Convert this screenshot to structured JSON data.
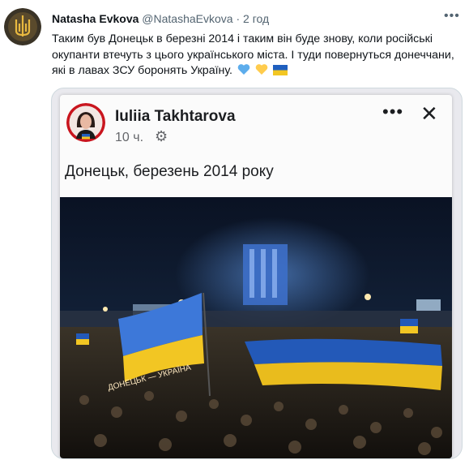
{
  "tweet": {
    "author_name": "Natasha Evkova",
    "author_handle": "@NatashaEvkova",
    "separator": "·",
    "time": "2 год",
    "more_label": "•••",
    "text": "Таким був Донецьк в березні 2014 і таким він буде знову, коли російські окупанти втечуть з цього українського міста. І туди повернуться донеччани, які в лавах ЗСУ боронять Україну.",
    "emojis": [
      "blue-heart",
      "yellow-heart",
      "ukraine-flag"
    ]
  },
  "embedded_post": {
    "author_name": "Iuliia Takhtarova",
    "time": "10 ч.",
    "more_label": "•••",
    "close_label": "✕",
    "caption": "Донецьк, березень 2014 року",
    "photo_watermark": "ДОНЕЦЬК — УКРАЇНА"
  },
  "colors": {
    "ukraine_blue": "#1f5fbf",
    "ukraine_yellow": "#f2c623",
    "text_primary": "#0f1419",
    "text_secondary": "#536471"
  }
}
